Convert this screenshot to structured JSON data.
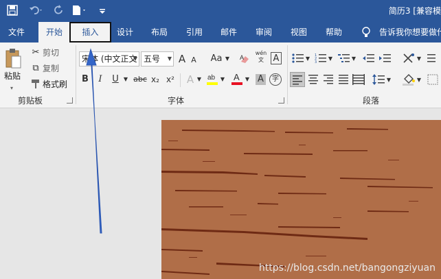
{
  "titlebar": {
    "doc_title": "简历3 [兼容模",
    "qa": {
      "save_icon": "save-icon",
      "undo_icon": "undo-icon",
      "redo_icon": "redo-icon",
      "new_icon": "new-doc-icon",
      "customize_icon": "customize-icon"
    }
  },
  "tabs": {
    "file": "文件",
    "home": "开始",
    "insert": "插入",
    "design": "设计",
    "layout": "布局",
    "references": "引用",
    "mailings": "邮件",
    "review": "审阅",
    "view": "视图",
    "help": "帮助",
    "tell_me": "告诉我你想要做什"
  },
  "clipboard": {
    "paste": "粘贴",
    "cut": "剪切",
    "copy": "复制",
    "format_painter": "格式刷",
    "label": "剪贴板"
  },
  "font": {
    "name": "宋体 (中文正文",
    "size": "五号",
    "label": "字体",
    "grow": "A",
    "shrink": "A",
    "case": "Aa",
    "phonetic": "wén",
    "border_char": "A",
    "bold": "B",
    "italic": "I",
    "underline": "U",
    "strike": "abc",
    "subscript": "x₂",
    "superscript": "x²",
    "text_effect": "A",
    "font_color": "A",
    "shading": "A",
    "enclose": "字"
  },
  "paragraph": {
    "label": "段落"
  },
  "colors": {
    "accent": "#2b579a",
    "highlight": "#ffff00",
    "font_color": "#e81123",
    "annotation": "#3466c8"
  },
  "watermark": "https://blog.csdn.net/bangongziyuan"
}
